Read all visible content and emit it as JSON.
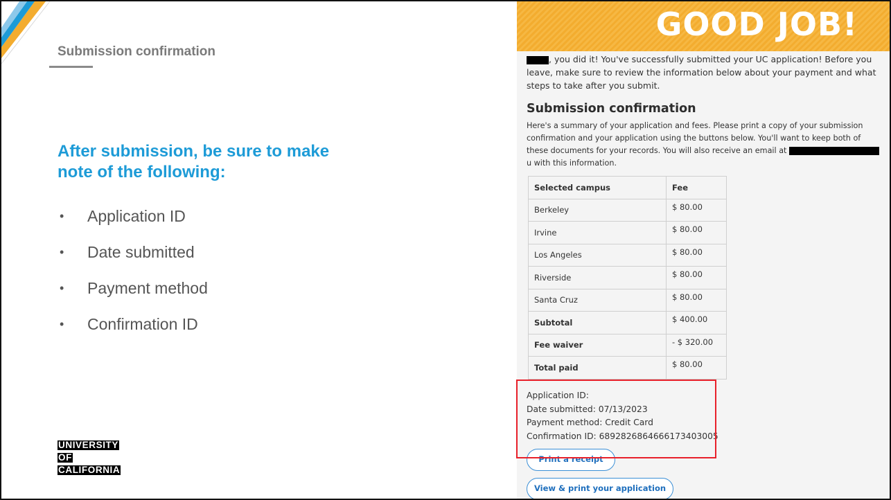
{
  "slide": {
    "title": "Submission confirmation",
    "heading": "After submission, be sure to make note of the following:",
    "bullets": [
      "Application ID",
      "Date submitted",
      "Payment method",
      "Confirmation ID"
    ],
    "logo": [
      "UNIVERSITY",
      "OF",
      "CALIFORNIA"
    ]
  },
  "panel": {
    "banner": "GOOD JOB!",
    "intro_text": ", you did it! You've successfully submitted your UC application! Before you leave, make sure to review the information below about your payment and what steps to take after you submit.",
    "section_title": "Submission confirmation",
    "section_text_1": "Here's a summary of your application and fees. Please print a copy of your submission confirmation and your application using the buttons below. You'll want to keep both of these documents for your records. You will also receive an email at ",
    "section_text_2": "u with this information.",
    "table": {
      "headers": [
        "Selected campus",
        "Fee"
      ],
      "rows": [
        {
          "campus": "Berkeley",
          "fee": "$ 80.00"
        },
        {
          "campus": "Irvine",
          "fee": "$ 80.00"
        },
        {
          "campus": "Los Angeles",
          "fee": "$ 80.00"
        },
        {
          "campus": "Riverside",
          "fee": "$ 80.00"
        },
        {
          "campus": "Santa Cruz",
          "fee": "$ 80.00"
        },
        {
          "campus": "Subtotal",
          "fee": "$ 400.00"
        },
        {
          "campus": "Fee waiver",
          "fee": "- $ 320.00"
        },
        {
          "campus": "Total paid",
          "fee": "$ 80.00"
        }
      ]
    },
    "details": {
      "application_id": "Application ID:",
      "date_submitted": "Date submitted: 07/13/2023",
      "payment_method": "Payment method: Credit Card",
      "confirmation_id": "Confirmation ID: 6892826864666173403005"
    },
    "buttons": {
      "print_receipt": "Print a receipt",
      "view_print": "View & print your application"
    }
  },
  "colors": {
    "heading_blue": "#1d9bd7",
    "banner_orange": "#f3ac2f",
    "highlight_red": "#e8202a",
    "button_blue": "#3b8fd6"
  }
}
